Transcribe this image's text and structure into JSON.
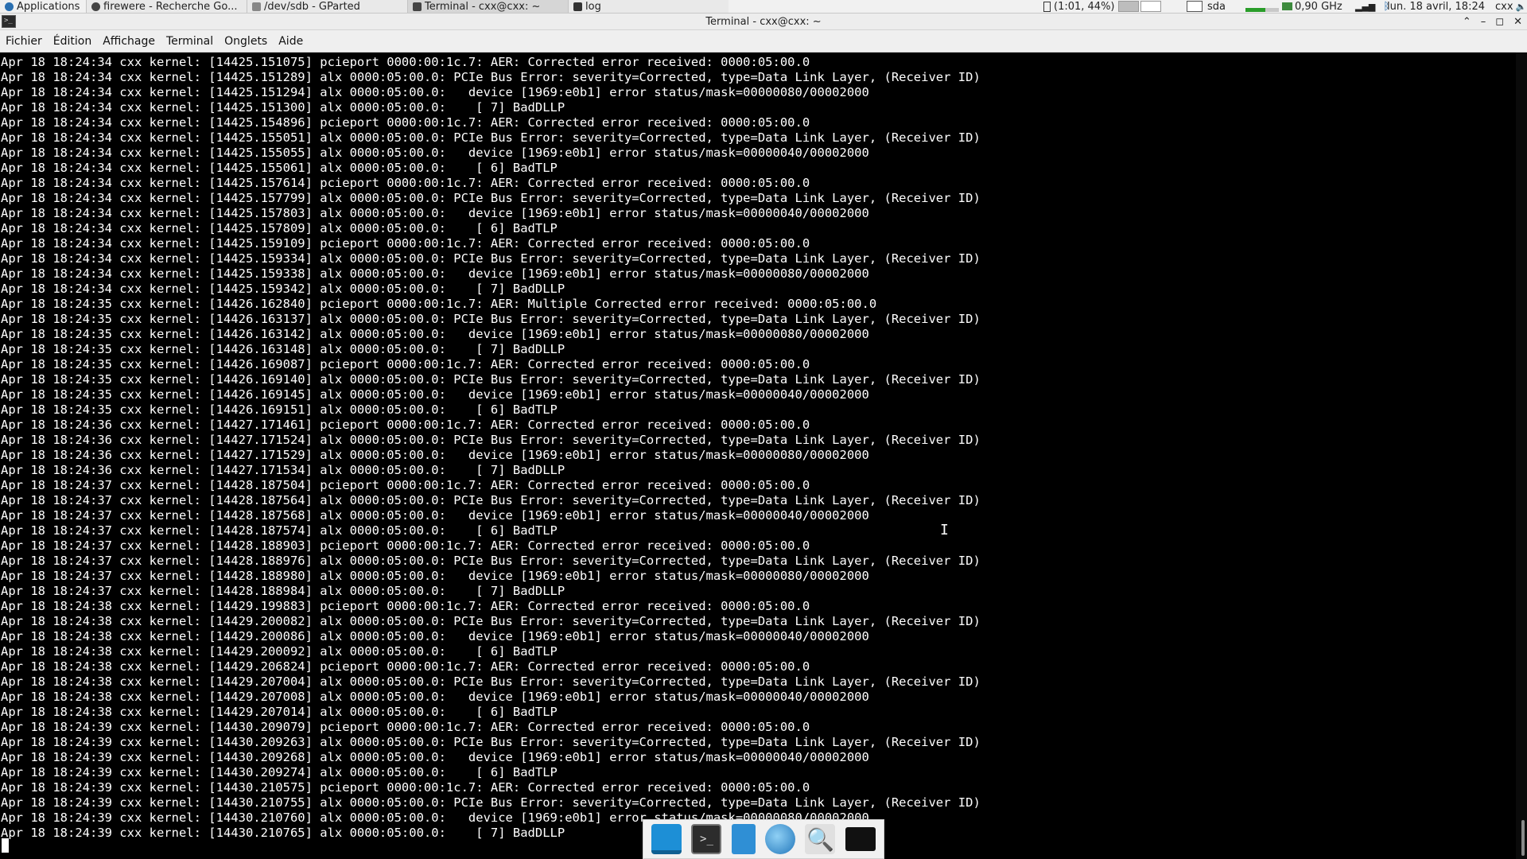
{
  "panel": {
    "apps_label": "Applications",
    "tasks": [
      {
        "label": "firewere - Recherche Go...",
        "icon": "browser-icon",
        "active": false
      },
      {
        "label": "/dev/sdb - GParted",
        "icon": "gparted-icon",
        "active": false
      },
      {
        "label": "Terminal - cxx@cxx: ~",
        "icon": "terminal-icon",
        "active": true
      },
      {
        "label": "log",
        "icon": "folder-icon",
        "active": false
      }
    ],
    "battery": "(1:01, 44%)",
    "disk": "sda",
    "cpu_freq": "0,90 GHz",
    "clock": "lun. 18 avril, 18:24",
    "user": "cxx"
  },
  "window": {
    "title": "Terminal - cxx@cxx: ~",
    "minimize": "–",
    "maximize": "◻",
    "close": "✕"
  },
  "menubar": [
    "Fichier",
    "Édition",
    "Affichage",
    "Terminal",
    "Onglets",
    "Aide"
  ],
  "log_lines": [
    "Apr 18 18:24:34 cxx kernel: [14425.151075] pcieport 0000:00:1c.7: AER: Corrected error received: 0000:05:00.0",
    "Apr 18 18:24:34 cxx kernel: [14425.151289] alx 0000:05:00.0: PCIe Bus Error: severity=Corrected, type=Data Link Layer, (Receiver ID)",
    "Apr 18 18:24:34 cxx kernel: [14425.151294] alx 0000:05:00.0:   device [1969:e0b1] error status/mask=00000080/00002000",
    "Apr 18 18:24:34 cxx kernel: [14425.151300] alx 0000:05:00.0:    [ 7] BadDLLP",
    "Apr 18 18:24:34 cxx kernel: [14425.154896] pcieport 0000:00:1c.7: AER: Corrected error received: 0000:05:00.0",
    "Apr 18 18:24:34 cxx kernel: [14425.155051] alx 0000:05:00.0: PCIe Bus Error: severity=Corrected, type=Data Link Layer, (Receiver ID)",
    "Apr 18 18:24:34 cxx kernel: [14425.155055] alx 0000:05:00.0:   device [1969:e0b1] error status/mask=00000040/00002000",
    "Apr 18 18:24:34 cxx kernel: [14425.155061] alx 0000:05:00.0:    [ 6] BadTLP",
    "Apr 18 18:24:34 cxx kernel: [14425.157614] pcieport 0000:00:1c.7: AER: Corrected error received: 0000:05:00.0",
    "Apr 18 18:24:34 cxx kernel: [14425.157799] alx 0000:05:00.0: PCIe Bus Error: severity=Corrected, type=Data Link Layer, (Receiver ID)",
    "Apr 18 18:24:34 cxx kernel: [14425.157803] alx 0000:05:00.0:   device [1969:e0b1] error status/mask=00000040/00002000",
    "Apr 18 18:24:34 cxx kernel: [14425.157809] alx 0000:05:00.0:    [ 6] BadTLP",
    "Apr 18 18:24:34 cxx kernel: [14425.159109] pcieport 0000:00:1c.7: AER: Corrected error received: 0000:05:00.0",
    "Apr 18 18:24:34 cxx kernel: [14425.159334] alx 0000:05:00.0: PCIe Bus Error: severity=Corrected, type=Data Link Layer, (Receiver ID)",
    "Apr 18 18:24:34 cxx kernel: [14425.159338] alx 0000:05:00.0:   device [1969:e0b1] error status/mask=00000080/00002000",
    "Apr 18 18:24:34 cxx kernel: [14425.159342] alx 0000:05:00.0:    [ 7] BadDLLP",
    "Apr 18 18:24:35 cxx kernel: [14426.162840] pcieport 0000:00:1c.7: AER: Multiple Corrected error received: 0000:05:00.0",
    "Apr 18 18:24:35 cxx kernel: [14426.163137] alx 0000:05:00.0: PCIe Bus Error: severity=Corrected, type=Data Link Layer, (Receiver ID)",
    "Apr 18 18:24:35 cxx kernel: [14426.163142] alx 0000:05:00.0:   device [1969:e0b1] error status/mask=00000080/00002000",
    "Apr 18 18:24:35 cxx kernel: [14426.163148] alx 0000:05:00.0:    [ 7] BadDLLP",
    "Apr 18 18:24:35 cxx kernel: [14426.169087] pcieport 0000:00:1c.7: AER: Corrected error received: 0000:05:00.0",
    "Apr 18 18:24:35 cxx kernel: [14426.169140] alx 0000:05:00.0: PCIe Bus Error: severity=Corrected, type=Data Link Layer, (Receiver ID)",
    "Apr 18 18:24:35 cxx kernel: [14426.169145] alx 0000:05:00.0:   device [1969:e0b1] error status/mask=00000040/00002000",
    "Apr 18 18:24:35 cxx kernel: [14426.169151] alx 0000:05:00.0:    [ 6] BadTLP",
    "Apr 18 18:24:36 cxx kernel: [14427.171461] pcieport 0000:00:1c.7: AER: Corrected error received: 0000:05:00.0",
    "Apr 18 18:24:36 cxx kernel: [14427.171524] alx 0000:05:00.0: PCIe Bus Error: severity=Corrected, type=Data Link Layer, (Receiver ID)",
    "Apr 18 18:24:36 cxx kernel: [14427.171529] alx 0000:05:00.0:   device [1969:e0b1] error status/mask=00000080/00002000",
    "Apr 18 18:24:36 cxx kernel: [14427.171534] alx 0000:05:00.0:    [ 7] BadDLLP",
    "Apr 18 18:24:37 cxx kernel: [14428.187504] pcieport 0000:00:1c.7: AER: Corrected error received: 0000:05:00.0",
    "Apr 18 18:24:37 cxx kernel: [14428.187564] alx 0000:05:00.0: PCIe Bus Error: severity=Corrected, type=Data Link Layer, (Receiver ID)",
    "Apr 18 18:24:37 cxx kernel: [14428.187568] alx 0000:05:00.0:   device [1969:e0b1] error status/mask=00000040/00002000",
    "Apr 18 18:24:37 cxx kernel: [14428.187574] alx 0000:05:00.0:    [ 6] BadTLP",
    "Apr 18 18:24:37 cxx kernel: [14428.188903] pcieport 0000:00:1c.7: AER: Corrected error received: 0000:05:00.0",
    "Apr 18 18:24:37 cxx kernel: [14428.188976] alx 0000:05:00.0: PCIe Bus Error: severity=Corrected, type=Data Link Layer, (Receiver ID)",
    "Apr 18 18:24:37 cxx kernel: [14428.188980] alx 0000:05:00.0:   device [1969:e0b1] error status/mask=00000080/00002000",
    "Apr 18 18:24:37 cxx kernel: [14428.188984] alx 0000:05:00.0:    [ 7] BadDLLP",
    "Apr 18 18:24:38 cxx kernel: [14429.199883] pcieport 0000:00:1c.7: AER: Corrected error received: 0000:05:00.0",
    "Apr 18 18:24:38 cxx kernel: [14429.200082] alx 0000:05:00.0: PCIe Bus Error: severity=Corrected, type=Data Link Layer, (Receiver ID)",
    "Apr 18 18:24:38 cxx kernel: [14429.200086] alx 0000:05:00.0:   device [1969:e0b1] error status/mask=00000040/00002000",
    "Apr 18 18:24:38 cxx kernel: [14429.200092] alx 0000:05:00.0:    [ 6] BadTLP",
    "Apr 18 18:24:38 cxx kernel: [14429.206824] pcieport 0000:00:1c.7: AER: Corrected error received: 0000:05:00.0",
    "Apr 18 18:24:38 cxx kernel: [14429.207004] alx 0000:05:00.0: PCIe Bus Error: severity=Corrected, type=Data Link Layer, (Receiver ID)",
    "Apr 18 18:24:38 cxx kernel: [14429.207008] alx 0000:05:00.0:   device [1969:e0b1] error status/mask=00000040/00002000",
    "Apr 18 18:24:38 cxx kernel: [14429.207014] alx 0000:05:00.0:    [ 6] BadTLP",
    "Apr 18 18:24:39 cxx kernel: [14430.209079] pcieport 0000:00:1c.7: AER: Corrected error received: 0000:05:00.0",
    "Apr 18 18:24:39 cxx kernel: [14430.209263] alx 0000:05:00.0: PCIe Bus Error: severity=Corrected, type=Data Link Layer, (Receiver ID)",
    "Apr 18 18:24:39 cxx kernel: [14430.209268] alx 0000:05:00.0:   device [1969:e0b1] error status/mask=00000040/00002000",
    "Apr 18 18:24:39 cxx kernel: [14430.209274] alx 0000:05:00.0:    [ 6] BadTLP",
    "Apr 18 18:24:39 cxx kernel: [14430.210575] pcieport 0000:00:1c.7: AER: Corrected error received: 0000:05:00.0",
    "Apr 18 18:24:39 cxx kernel: [14430.210755] alx 0000:05:00.0: PCIe Bus Error: severity=Corrected, type=Data Link Layer, (Receiver ID)",
    "Apr 18 18:24:39 cxx kernel: [14430.210760] alx 0000:05:00.0:   device [1969:e0b1] error status/mask=00000080/00002000",
    "Apr 18 18:24:39 cxx kernel: [14430.210765] alx 0000:05:00.0:    [ 7] BadDLLP"
  ],
  "dock": [
    {
      "name": "desktop-icon"
    },
    {
      "name": "terminal-icon",
      "glyph": ">_"
    },
    {
      "name": "file-manager-icon"
    },
    {
      "name": "web-browser-icon"
    },
    {
      "name": "app-finder-icon",
      "glyph": "🔍"
    },
    {
      "name": "folder-icon"
    }
  ]
}
